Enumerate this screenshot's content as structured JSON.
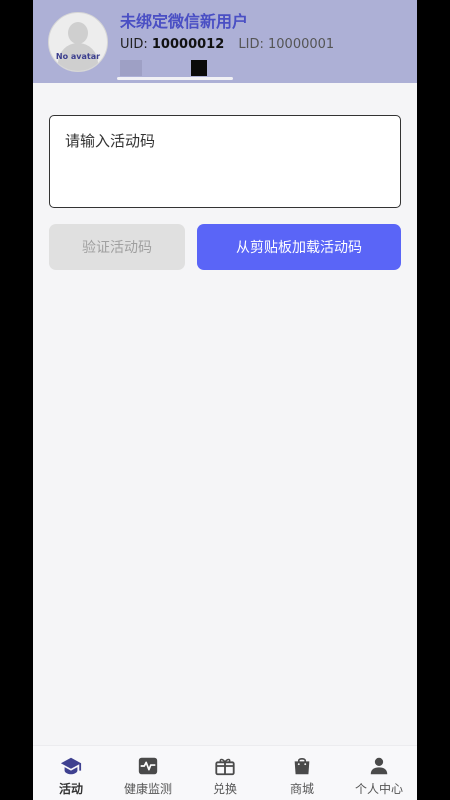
{
  "header": {
    "user_name": "未绑定微信新用户",
    "uid_label": "UID:",
    "uid_value": "10000012",
    "lid_text": "LID: 10000001",
    "avatar_text": "No avatar"
  },
  "code_input": {
    "placeholder": "请输入活动码"
  },
  "buttons": {
    "verify_label": "验证活动码",
    "load_label": "从剪贴板加载活动码"
  },
  "nav": {
    "items": [
      {
        "label": "活动",
        "icon": "graduation-cap-icon",
        "active": true
      },
      {
        "label": "健康监测",
        "icon": "heartbeat-icon",
        "active": false
      },
      {
        "label": "兑换",
        "icon": "gift-icon",
        "active": false
      },
      {
        "label": "商城",
        "icon": "shopping-bag-icon",
        "active": false
      },
      {
        "label": "个人中心",
        "icon": "person-icon",
        "active": false
      }
    ]
  },
  "colors": {
    "header_bg": "#adb0d6",
    "accent": "#5a65f7",
    "name_color": "#4a4fc4",
    "disabled_bg": "#e0e0e0"
  }
}
